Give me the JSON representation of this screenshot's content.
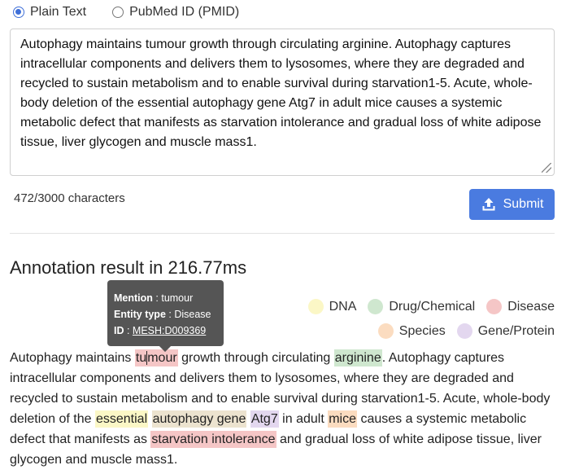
{
  "input_mode": {
    "options": [
      {
        "label": "Plain Text",
        "checked": true
      },
      {
        "label": "PubMed ID (PMID)",
        "checked": false
      }
    ]
  },
  "input": {
    "text": "Autophagy maintains tumour growth through circulating arginine. Autophagy captures intracellular components and delivers them to lysosomes, where they are degraded and recycled to sustain metabolism and to enable survival during starvation1-5. Acute, whole-body deletion of the essential autophagy gene Atg7 in adult mice causes a systemic metabolic defect that manifests as starvation intolerance and gradual loss of white adipose tissue, liver glycogen and muscle mass1.",
    "char_count": "472/3000 characters"
  },
  "submit": {
    "label": "Submit",
    "icon": "upload-icon"
  },
  "result": {
    "title": "Annotation result in 216.77ms"
  },
  "legend": [
    {
      "label": "DNA",
      "color": "#fbf7c6"
    },
    {
      "label": "Drug/Chemical",
      "color": "#cfe7cf"
    },
    {
      "label": "Disease",
      "color": "#f5c6c6"
    },
    {
      "label": "Species",
      "color": "#fbdcc0"
    },
    {
      "label": "Gene/Protein",
      "color": "#e3d7ef"
    }
  ],
  "tooltip": {
    "mention_key": "Mention",
    "mention_value": "tumour",
    "type_key": "Entity type",
    "type_value": "Disease",
    "id_key": "ID",
    "id_value": "MESH:D009369"
  },
  "annotated": {
    "t0": "Autophagy maintains ",
    "e_tumour_a": "tu",
    "e_tumour_b": "mour",
    "t1": " growth through circulating ",
    "e_arginine": "arginine",
    "t2": ". Autophagy captures intracellular components and delivers them to lysosomes, where they are degraded and recycled to sustain metabolism and to enable survival during starvation1-5. Acute, whole-body deletion of the ",
    "e_essential": "essential",
    "t3": " ",
    "e_autophagy_gene": "autophagy gene",
    "t4": " ",
    "e_atg7": "Atg7",
    "t5": " in adult ",
    "e_mice": "mice",
    "t6": " causes a systemic metabolic defect that manifests as ",
    "e_starvation": "starvation intolerance",
    "t7": " and gradual loss of white adipose tissue, liver glycogen and muscle mass1."
  }
}
